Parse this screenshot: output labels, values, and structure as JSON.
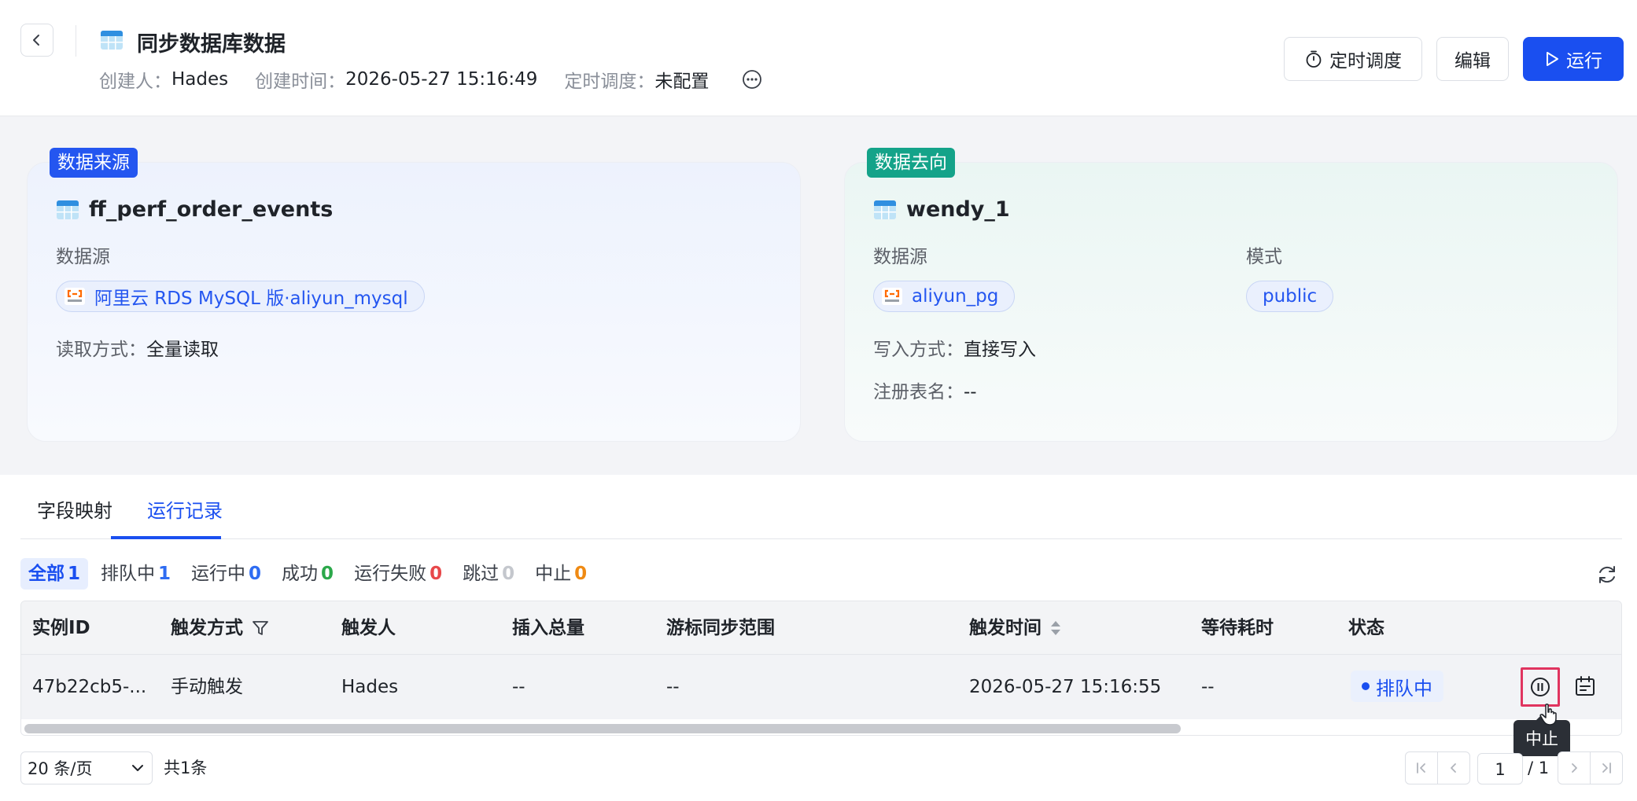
{
  "header": {
    "title": "同步数据库数据",
    "meta": {
      "creator_label": "创建人：",
      "creator": "Hades",
      "created_label": "创建时间：",
      "created_time": "2026-05-27 15:16:49",
      "schedule_label": "定时调度：",
      "schedule_value": "未配置"
    },
    "buttons": {
      "schedule": "定时调度",
      "edit": "编辑",
      "run": "运行"
    }
  },
  "source_card": {
    "tag": "数据来源",
    "table_name": "ff_perf_order_events",
    "datasource_label": "数据源",
    "datasource": "阿里云 RDS MySQL 版·aliyun_mysql",
    "read_mode_label": "读取方式：",
    "read_mode": "全量读取"
  },
  "target_card": {
    "tag": "数据去向",
    "table_name": "wendy_1",
    "datasource_label": "数据源",
    "datasource": "aliyun_pg",
    "schema_label": "模式",
    "schema": "public",
    "write_mode_label": "写入方式：",
    "write_mode": "直接写入",
    "register_label": "注册表名：",
    "register_value": "--"
  },
  "tabs": [
    {
      "label": "字段映射",
      "active": false
    },
    {
      "label": "运行记录",
      "active": true
    }
  ],
  "filters": [
    {
      "label": "全部",
      "count": "1",
      "active": true
    },
    {
      "label": "排队中",
      "count": "1"
    },
    {
      "label": "运行中",
      "count": "0"
    },
    {
      "label": "成功",
      "count": "0"
    },
    {
      "label": "运行失败",
      "count": "0"
    },
    {
      "label": "跳过",
      "count": "0"
    },
    {
      "label": "中止",
      "count": "0"
    }
  ],
  "table": {
    "columns": [
      "实例ID",
      "触发方式",
      "触发人",
      "插入总量",
      "游标同步范围",
      "触发时间",
      "等待耗时",
      "状态"
    ],
    "rows": [
      {
        "instance_id": "47b22cb5-...",
        "trigger_mode": "手动触发",
        "trigger_user": "Hades",
        "insert_total": "--",
        "cursor_range": "--",
        "trigger_time": "2026-05-27 15:16:55",
        "wait_time": "--",
        "status": "排队中"
      }
    ]
  },
  "tooltip": "中止",
  "pagination": {
    "page_size": "20 条/页",
    "total": "共1条",
    "current": "1",
    "total_pages": "/ 1"
  },
  "colors": {
    "primary": "#1a4ff0",
    "source_tag": "#2456f0",
    "target_tag": "#14a389",
    "stop_highlight": "#e0345f"
  }
}
